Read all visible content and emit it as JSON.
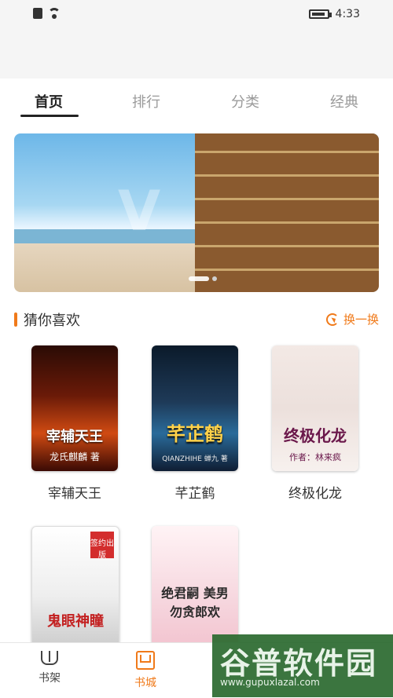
{
  "status_bar": {
    "time": "4:33"
  },
  "tabs": [
    {
      "label": "首页",
      "active": true
    },
    {
      "label": "排行",
      "active": false
    },
    {
      "label": "分类",
      "active": false
    },
    {
      "label": "经典",
      "active": false
    }
  ],
  "banner": {
    "overlay_text": "V"
  },
  "section": {
    "title": "猜你喜欢",
    "swap_label": "换一换"
  },
  "books": [
    {
      "title": "宰辅天王",
      "cover_title": "宰辅天王",
      "cover_author": "龙氏麒麟 著"
    },
    {
      "title": "芊芷鹤",
      "cover_title": "芊芷鹤",
      "cover_author": "QIANZHIHE 蝉九 著"
    },
    {
      "title": "终极化龙",
      "cover_title": "终极化龙",
      "cover_author": "作者：林来疯"
    },
    {
      "title": "",
      "cover_title": "鬼眼神瞳",
      "cover_author": "签约出版"
    },
    {
      "title": "",
      "cover_title": "绝君嗣 美男勿贪郎欢",
      "cover_author": ""
    }
  ],
  "bottom_nav": [
    {
      "label": "书架",
      "active": false
    },
    {
      "label": "书城",
      "active": true
    }
  ],
  "watermark": {
    "line1": "谷普软件园",
    "line2": "www.gupuxlazal.com"
  },
  "colors": {
    "accent": "#f07a1a"
  }
}
